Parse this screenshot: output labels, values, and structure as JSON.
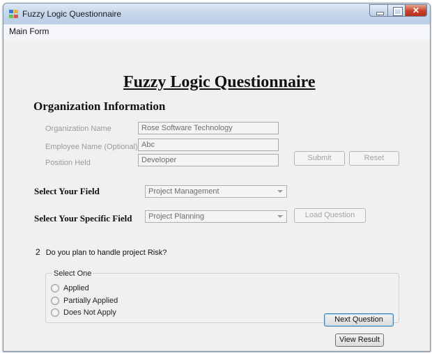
{
  "window": {
    "title": "Fuzzy Logic Questionnaire",
    "close_glyph": "✕"
  },
  "menu": {
    "main_form": "Main Form"
  },
  "main_title": "Fuzzy Logic Questionnaire",
  "organization": {
    "section_title": "Organization Information",
    "org_name_label": "Organization Name",
    "org_name_value": "Rose Software Technology",
    "employee_label": "Employee Name (Optional)",
    "employee_value": "Abc",
    "position_label": "Position Held",
    "position_value": "Developer",
    "submit_label": "Submit",
    "reset_label": "Reset"
  },
  "field": {
    "label": "Select Your Field",
    "value": "Project Management"
  },
  "specific_field": {
    "label": "Select Your Specific Field",
    "value": "Project Planning",
    "load_label": "Load Question"
  },
  "question": {
    "number": "2",
    "text": "Do you plan to handle project Risk?"
  },
  "options": {
    "title": "Select One",
    "items": [
      "Applied",
      "Partially Applied",
      "Does Not Apply"
    ]
  },
  "actions": {
    "next_label": "Next Question",
    "view_result_label": "View Result"
  }
}
